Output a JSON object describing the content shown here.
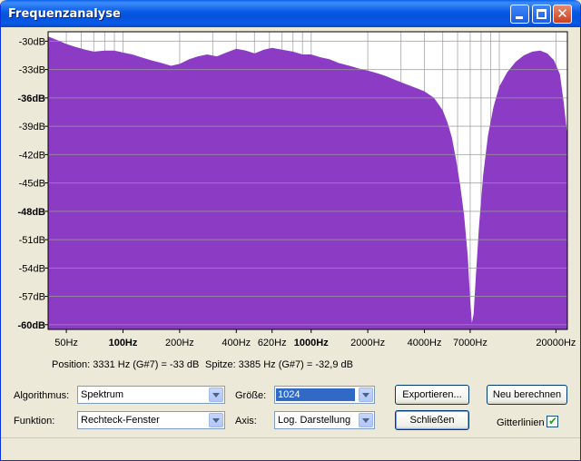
{
  "window": {
    "title": "Frequenzanalyse"
  },
  "chart_data": {
    "type": "area",
    "y_ticks": [
      "-30dB",
      "-33dB",
      "-36dB",
      "-39dB",
      "-42dB",
      "-45dB",
      "-48dB",
      "-51dB",
      "-54dB",
      "-57dB",
      "-60dB"
    ],
    "y_bold": [
      "-36dB",
      "-48dB",
      "-60dB"
    ],
    "x_ticks": [
      {
        "label": "50Hz",
        "hz": 50
      },
      {
        "label": "100Hz",
        "hz": 100,
        "bold": true
      },
      {
        "label": "200Hz",
        "hz": 200
      },
      {
        "label": "400Hz",
        "hz": 400
      },
      {
        "label": "620Hz",
        "hz": 620
      },
      {
        "label": "1000Hz",
        "hz": 1000,
        "bold": true
      },
      {
        "label": "2000Hz",
        "hz": 2000
      },
      {
        "label": "4000Hz",
        "hz": 4000
      },
      {
        "label": "7000Hz",
        "hz": 7000
      },
      {
        "label": "20000Hz",
        "hz": 20000
      }
    ],
    "xlim": [
      40,
      23000
    ],
    "ylim": [
      -60.5,
      -29
    ],
    "x_scale": "log",
    "grid": true,
    "series": [
      {
        "color": "#8c3cc4",
        "points": [
          [
            40,
            -29.5
          ],
          [
            45,
            -29.9
          ],
          [
            50,
            -30.3
          ],
          [
            56,
            -30.6
          ],
          [
            63,
            -30.9
          ],
          [
            70,
            -31.1
          ],
          [
            80,
            -31.0
          ],
          [
            90,
            -31.0
          ],
          [
            100,
            -31.2
          ],
          [
            112,
            -31.4
          ],
          [
            125,
            -31.7
          ],
          [
            140,
            -32.0
          ],
          [
            160,
            -32.3
          ],
          [
            180,
            -32.6
          ],
          [
            200,
            -32.4
          ],
          [
            225,
            -31.9
          ],
          [
            250,
            -31.6
          ],
          [
            280,
            -31.4
          ],
          [
            315,
            -31.6
          ],
          [
            355,
            -31.2
          ],
          [
            400,
            -30.8
          ],
          [
            450,
            -31.0
          ],
          [
            500,
            -31.3
          ],
          [
            560,
            -30.9
          ],
          [
            620,
            -30.7
          ],
          [
            700,
            -30.9
          ],
          [
            800,
            -31.1
          ],
          [
            900,
            -31.4
          ],
          [
            1000,
            -31.4
          ],
          [
            1120,
            -31.7
          ],
          [
            1250,
            -31.9
          ],
          [
            1400,
            -32.3
          ],
          [
            1600,
            -32.6
          ],
          [
            1800,
            -32.9
          ],
          [
            2000,
            -33.1
          ],
          [
            2250,
            -33.4
          ],
          [
            2500,
            -33.7
          ],
          [
            2800,
            -34.1
          ],
          [
            3150,
            -34.5
          ],
          [
            3550,
            -34.9
          ],
          [
            4000,
            -35.3
          ],
          [
            4500,
            -36.0
          ],
          [
            5000,
            -37.3
          ],
          [
            5300,
            -38.6
          ],
          [
            5600,
            -40.2
          ],
          [
            5900,
            -42.6
          ],
          [
            6200,
            -45.3
          ],
          [
            6500,
            -48.4
          ],
          [
            6800,
            -52.8
          ],
          [
            7000,
            -57.4
          ],
          [
            7150,
            -59.8
          ],
          [
            7300,
            -58.9
          ],
          [
            7500,
            -55.0
          ],
          [
            7800,
            -49.5
          ],
          [
            8200,
            -44.2
          ],
          [
            8700,
            -40.0
          ],
          [
            9300,
            -37.0
          ],
          [
            10000,
            -34.8
          ],
          [
            11000,
            -33.3
          ],
          [
            12200,
            -32.2
          ],
          [
            13500,
            -31.5
          ],
          [
            15000,
            -31.1
          ],
          [
            16500,
            -31.0
          ],
          [
            18000,
            -31.3
          ],
          [
            19500,
            -32.0
          ],
          [
            21000,
            -33.5
          ],
          [
            22000,
            -36.5
          ],
          [
            23000,
            -40.0
          ]
        ]
      }
    ]
  },
  "status": {
    "position": "Position: 3331 Hz (G#7) = -33 dB",
    "peak": "Spitze: 3385 Hz (G#7) = -32,9 dB"
  },
  "controls": {
    "algorithm_label": "Algorithmus:",
    "algorithm_value": "Spektrum",
    "function_label": "Funktion:",
    "function_value": "Rechteck-Fenster",
    "size_label": "Größe:",
    "size_value": "1024",
    "axis_label": "Axis:",
    "axis_value": "Log. Darstellung",
    "export_button": "Exportieren...",
    "recalc_button": "Neu berechnen",
    "close_button": "Schließen",
    "grid_checkbox_label": "Gitterlinien",
    "grid_checked": true
  },
  "colors": {
    "spectrum": "#8c3cc4",
    "selection": "#316ac5",
    "titlebar": "#0758e3"
  }
}
